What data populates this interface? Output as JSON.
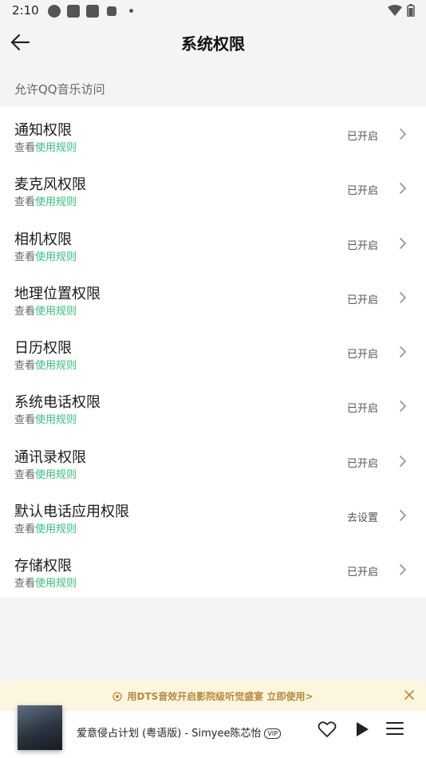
{
  "status_bar": {
    "time": "2:10"
  },
  "header": {
    "title": "系统权限"
  },
  "section": {
    "label": "允许QQ音乐访问"
  },
  "permissions": [
    {
      "name": "通知权限",
      "sub_prefix": "查看",
      "sub_link": "使用规则",
      "status": "已开启"
    },
    {
      "name": "麦克风权限",
      "sub_prefix": "查看",
      "sub_link": "使用规则",
      "status": "已开启"
    },
    {
      "name": "相机权限",
      "sub_prefix": "查看",
      "sub_link": "使用规则",
      "status": "已开启"
    },
    {
      "name": "地理位置权限",
      "sub_prefix": "查看",
      "sub_link": "使用规则",
      "status": "已开启"
    },
    {
      "name": "日历权限",
      "sub_prefix": "查看",
      "sub_link": "使用规则",
      "status": "已开启"
    },
    {
      "name": "系统电话权限",
      "sub_prefix": "查看",
      "sub_link": "使用规则",
      "status": "已开启"
    },
    {
      "name": "通讯录权限",
      "sub_prefix": "查看",
      "sub_link": "使用规则",
      "status": "已开启"
    },
    {
      "name": "默认电话应用权限",
      "sub_prefix": "查看",
      "sub_link": "使用规则",
      "status": "去设置"
    },
    {
      "name": "存储权限",
      "sub_prefix": "查看",
      "sub_link": "使用规则",
      "status": "已开启"
    }
  ],
  "banner": {
    "text": "用DTS音效开启影院级听觉盛宴 立即使用>"
  },
  "player": {
    "song": "爱意侵占计划 (粤语版) - Simyee陈芯怡",
    "vip_badge": "VIP"
  },
  "colors": {
    "accent": "#31c27c",
    "banner_bg": "#fdf6df",
    "banner_text": "#b8893a"
  }
}
